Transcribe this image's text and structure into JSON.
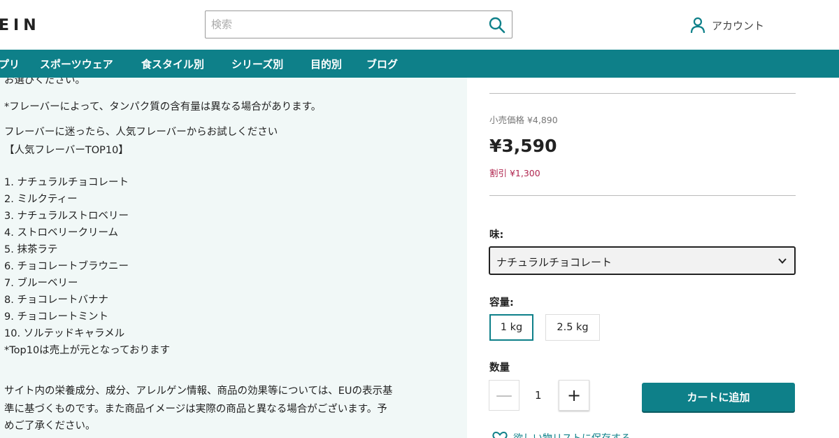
{
  "header": {
    "logo": "EIN",
    "search_placeholder": "検索",
    "account_label": "アカウント"
  },
  "nav": {
    "items": [
      "プリ",
      "スポーツウェア",
      "食スタイル別",
      "シリーズ別",
      "目的別",
      "ブログ"
    ]
  },
  "description": {
    "lines": [
      "お選びください。",
      "*フレーバーによって、タンパク質の含有量は異なる場合があります。",
      "フレーバーに迷ったら、人気フレーバーからお試しください",
      "【人気フレーバーTOP10】",
      "1. ナチュラルチョコレート",
      "2. ミルクティー",
      "3. ナチュラルストロベリー",
      "4. ストロベリークリーム",
      "5. 抹茶ラテ",
      "6. チョコレートブラウニー",
      "7. ブルーベリー",
      "8. チョコレートバナナ",
      "9. チョコレートミント",
      "10. ソルテッドキャラメル",
      "*Top10は売上が元となっております",
      "サイト内の栄養成分、成分、アレルゲン情報、商品の効果等については、EUの表示基",
      "準に基づくものです。また商品イメージは実際の商品と異なる場合がございます。予",
      "めご了承ください。"
    ]
  },
  "product": {
    "retail_price": "小売価格 ¥4,890",
    "price": "¥3,590",
    "discount": "割引 ¥1,300",
    "flavor_label": "味:",
    "flavor_selected": "ナチュラルチョコレート",
    "size_label": "容量:",
    "sizes": [
      "1 kg",
      "2.5 kg"
    ],
    "selected_size": "1 kg",
    "quantity_label": "数量",
    "quantity_value": "1",
    "minus_symbol": "—",
    "plus_symbol": "+",
    "add_to_cart": "カートに追加",
    "wishlist_label": "欲しい物リストに保存する"
  },
  "colors": {
    "brand": "#0e8089",
    "discount": "#b0264f",
    "left_bg": "#f1f8f7"
  }
}
